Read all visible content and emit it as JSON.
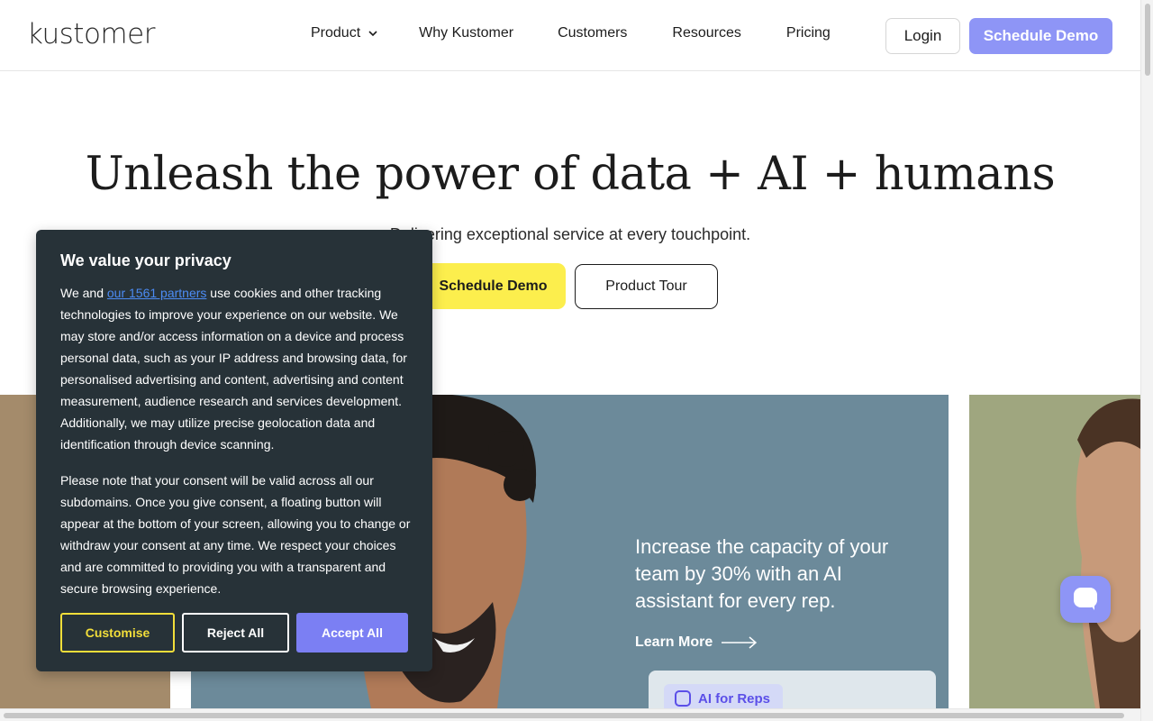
{
  "header": {
    "logo": "kustomer",
    "nav": [
      {
        "label": "Product",
        "has_dropdown": true
      },
      {
        "label": "Why Kustomer"
      },
      {
        "label": "Customers"
      },
      {
        "label": "Resources"
      },
      {
        "label": "Pricing"
      }
    ],
    "login_label": "Login",
    "demo_label": "Schedule Demo"
  },
  "hero": {
    "title": "Unleash the power of data + AI + humans",
    "subtitle": "Delivering exceptional service at every touchpoint.",
    "demo_label": "Schedule Demo",
    "tour_label": "Product Tour"
  },
  "feature": {
    "text": "Increase the capacity of your team by 30% with an AI assistant for every rep.",
    "link_label": "Learn More",
    "chip_label": "AI for Reps"
  },
  "cookie": {
    "title": "We value your privacy",
    "p1_before": "We and ",
    "p1_link": "our 1561 partners",
    "p1_after": " use cookies and other tracking technologies to improve your experience on our website. We may store and/or access information on a device and process personal data, such as your IP address and browsing data, for personalised advertising and content, advertising and content measurement, audience research and services development. Additionally, we may utilize precise geolocation data and identification through device scanning.",
    "p2": "Please note that your consent will be valid across all our subdomains. Once you give consent, a floating button will appear at the bottom of your screen, allowing you to change or withdraw your consent at any time. We respect your choices and are committed to providing you with a transparent and secure browsing experience.",
    "customise_label": "Customise",
    "reject_label": "Reject All",
    "accept_label": "Accept All"
  },
  "colors": {
    "accent": "#8e95f6",
    "cta_yellow": "#fcee4d",
    "modal_bg": "#273238",
    "panel_blue": "#6c8a9a"
  },
  "icons": [
    "chevron-down-icon",
    "arrow-right-icon",
    "chat-icon",
    "ai-robot-icon"
  ]
}
